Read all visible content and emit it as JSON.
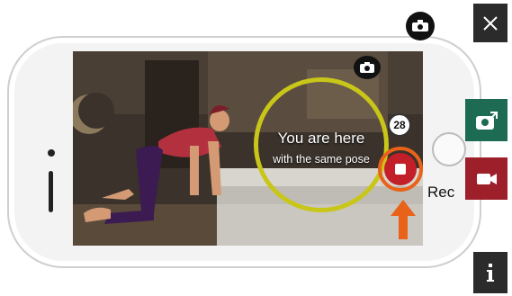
{
  "overlay": {
    "line1": "You are here",
    "line2": "with the same pose",
    "counter": "28"
  },
  "recording": {
    "label": "Rec"
  },
  "icons": {
    "top_camera": "switch-camera-icon",
    "close": "close-icon",
    "photo": "camera-share-icon",
    "video": "video-camera-icon",
    "info": "info-icon",
    "screen_camera": "switch-camera-icon",
    "arrow": "arrow-up-icon"
  },
  "colors": {
    "close_bg": "#2b2b2b",
    "photo_bg": "#1d6b52",
    "video_bg": "#9c1f2a",
    "info_bg": "#2b2b2b",
    "overlay_ring": "#c9c61a",
    "rec_ring": "#e9621a",
    "rec_button": "#c21f28",
    "arrow": "#e9621a"
  }
}
